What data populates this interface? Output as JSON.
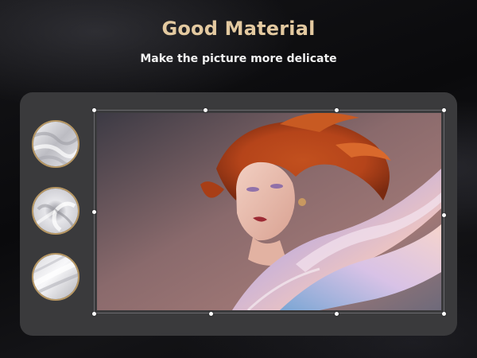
{
  "header": {
    "title": "Good Material",
    "subtitle": "Make the picture more delicate"
  },
  "materials": [
    {
      "name": "silk-swatch-1",
      "icon": "fabric-drape-icon"
    },
    {
      "name": "silk-swatch-2",
      "icon": "fabric-swirl-icon"
    },
    {
      "name": "silk-swatch-3",
      "icon": "fabric-fold-icon"
    }
  ],
  "colors": {
    "title": "#e3c9a0",
    "subtitle": "#f2f2f2",
    "panel": "#3a3a3c",
    "swatch_border": "#b89864",
    "handle": "#ffffff"
  },
  "editor": {
    "image": "portrait-with-silk-fabric",
    "selection_handles": 8
  }
}
